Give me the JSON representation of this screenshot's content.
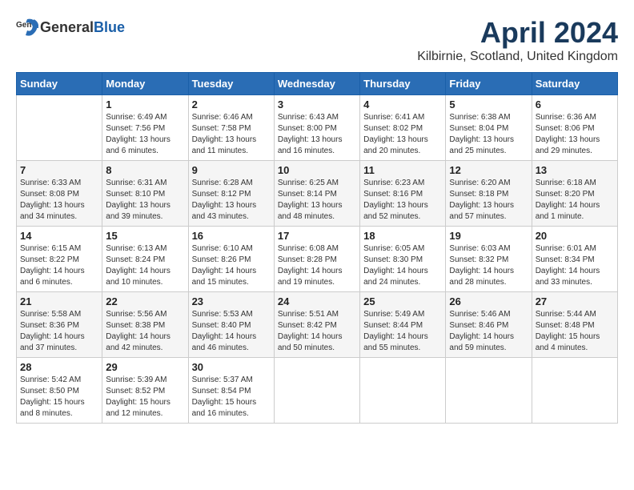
{
  "header": {
    "logo_general": "General",
    "logo_blue": "Blue",
    "month_title": "April 2024",
    "location": "Kilbirnie, Scotland, United Kingdom"
  },
  "calendar": {
    "days_of_week": [
      "Sunday",
      "Monday",
      "Tuesday",
      "Wednesday",
      "Thursday",
      "Friday",
      "Saturday"
    ],
    "weeks": [
      [
        {
          "day": "",
          "info": ""
        },
        {
          "day": "1",
          "info": "Sunrise: 6:49 AM\nSunset: 7:56 PM\nDaylight: 13 hours\nand 6 minutes."
        },
        {
          "day": "2",
          "info": "Sunrise: 6:46 AM\nSunset: 7:58 PM\nDaylight: 13 hours\nand 11 minutes."
        },
        {
          "day": "3",
          "info": "Sunrise: 6:43 AM\nSunset: 8:00 PM\nDaylight: 13 hours\nand 16 minutes."
        },
        {
          "day": "4",
          "info": "Sunrise: 6:41 AM\nSunset: 8:02 PM\nDaylight: 13 hours\nand 20 minutes."
        },
        {
          "day": "5",
          "info": "Sunrise: 6:38 AM\nSunset: 8:04 PM\nDaylight: 13 hours\nand 25 minutes."
        },
        {
          "day": "6",
          "info": "Sunrise: 6:36 AM\nSunset: 8:06 PM\nDaylight: 13 hours\nand 29 minutes."
        }
      ],
      [
        {
          "day": "7",
          "info": "Sunrise: 6:33 AM\nSunset: 8:08 PM\nDaylight: 13 hours\nand 34 minutes."
        },
        {
          "day": "8",
          "info": "Sunrise: 6:31 AM\nSunset: 8:10 PM\nDaylight: 13 hours\nand 39 minutes."
        },
        {
          "day": "9",
          "info": "Sunrise: 6:28 AM\nSunset: 8:12 PM\nDaylight: 13 hours\nand 43 minutes."
        },
        {
          "day": "10",
          "info": "Sunrise: 6:25 AM\nSunset: 8:14 PM\nDaylight: 13 hours\nand 48 minutes."
        },
        {
          "day": "11",
          "info": "Sunrise: 6:23 AM\nSunset: 8:16 PM\nDaylight: 13 hours\nand 52 minutes."
        },
        {
          "day": "12",
          "info": "Sunrise: 6:20 AM\nSunset: 8:18 PM\nDaylight: 13 hours\nand 57 minutes."
        },
        {
          "day": "13",
          "info": "Sunrise: 6:18 AM\nSunset: 8:20 PM\nDaylight: 14 hours\nand 1 minute."
        }
      ],
      [
        {
          "day": "14",
          "info": "Sunrise: 6:15 AM\nSunset: 8:22 PM\nDaylight: 14 hours\nand 6 minutes."
        },
        {
          "day": "15",
          "info": "Sunrise: 6:13 AM\nSunset: 8:24 PM\nDaylight: 14 hours\nand 10 minutes."
        },
        {
          "day": "16",
          "info": "Sunrise: 6:10 AM\nSunset: 8:26 PM\nDaylight: 14 hours\nand 15 minutes."
        },
        {
          "day": "17",
          "info": "Sunrise: 6:08 AM\nSunset: 8:28 PM\nDaylight: 14 hours\nand 19 minutes."
        },
        {
          "day": "18",
          "info": "Sunrise: 6:05 AM\nSunset: 8:30 PM\nDaylight: 14 hours\nand 24 minutes."
        },
        {
          "day": "19",
          "info": "Sunrise: 6:03 AM\nSunset: 8:32 PM\nDaylight: 14 hours\nand 28 minutes."
        },
        {
          "day": "20",
          "info": "Sunrise: 6:01 AM\nSunset: 8:34 PM\nDaylight: 14 hours\nand 33 minutes."
        }
      ],
      [
        {
          "day": "21",
          "info": "Sunrise: 5:58 AM\nSunset: 8:36 PM\nDaylight: 14 hours\nand 37 minutes."
        },
        {
          "day": "22",
          "info": "Sunrise: 5:56 AM\nSunset: 8:38 PM\nDaylight: 14 hours\nand 42 minutes."
        },
        {
          "day": "23",
          "info": "Sunrise: 5:53 AM\nSunset: 8:40 PM\nDaylight: 14 hours\nand 46 minutes."
        },
        {
          "day": "24",
          "info": "Sunrise: 5:51 AM\nSunset: 8:42 PM\nDaylight: 14 hours\nand 50 minutes."
        },
        {
          "day": "25",
          "info": "Sunrise: 5:49 AM\nSunset: 8:44 PM\nDaylight: 14 hours\nand 55 minutes."
        },
        {
          "day": "26",
          "info": "Sunrise: 5:46 AM\nSunset: 8:46 PM\nDaylight: 14 hours\nand 59 minutes."
        },
        {
          "day": "27",
          "info": "Sunrise: 5:44 AM\nSunset: 8:48 PM\nDaylight: 15 hours\nand 4 minutes."
        }
      ],
      [
        {
          "day": "28",
          "info": "Sunrise: 5:42 AM\nSunset: 8:50 PM\nDaylight: 15 hours\nand 8 minutes."
        },
        {
          "day": "29",
          "info": "Sunrise: 5:39 AM\nSunset: 8:52 PM\nDaylight: 15 hours\nand 12 minutes."
        },
        {
          "day": "30",
          "info": "Sunrise: 5:37 AM\nSunset: 8:54 PM\nDaylight: 15 hours\nand 16 minutes."
        },
        {
          "day": "",
          "info": ""
        },
        {
          "day": "",
          "info": ""
        },
        {
          "day": "",
          "info": ""
        },
        {
          "day": "",
          "info": ""
        }
      ]
    ]
  }
}
